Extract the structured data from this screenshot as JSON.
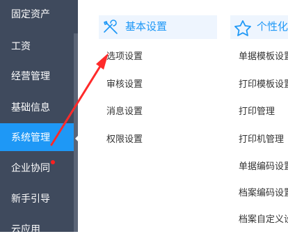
{
  "sidebar": {
    "items": [
      {
        "label": "固定资产"
      },
      {
        "label": "工资"
      },
      {
        "label": "经营管理"
      },
      {
        "label": "基础信息"
      },
      {
        "label": "系统管理",
        "active": true
      },
      {
        "label": "企业协同",
        "has_notice_dot": true
      },
      {
        "label": "新手引导"
      },
      {
        "label": "云应用"
      }
    ]
  },
  "sections": {
    "basic": {
      "title": "基本设置",
      "icon": "settings-tools-icon",
      "items": [
        "选项设置",
        "审核设置",
        "消息设置",
        "权限设置"
      ]
    },
    "personal": {
      "title": "个性化",
      "icon": "star-icon",
      "items": [
        "单据模板设置",
        "打印模板设置",
        "打印管理",
        "打印机管理",
        "单据编码设置",
        "档案编码设置",
        "档案自定义设置"
      ]
    }
  },
  "annotation": {
    "type": "red-arrow",
    "color": "#ff2a2a"
  },
  "colors": {
    "sidebar_bg": "#3f4a5d",
    "active_bg": "#1e98f6",
    "accent": "#1e98f6",
    "header_bg": "#eef5fe"
  }
}
